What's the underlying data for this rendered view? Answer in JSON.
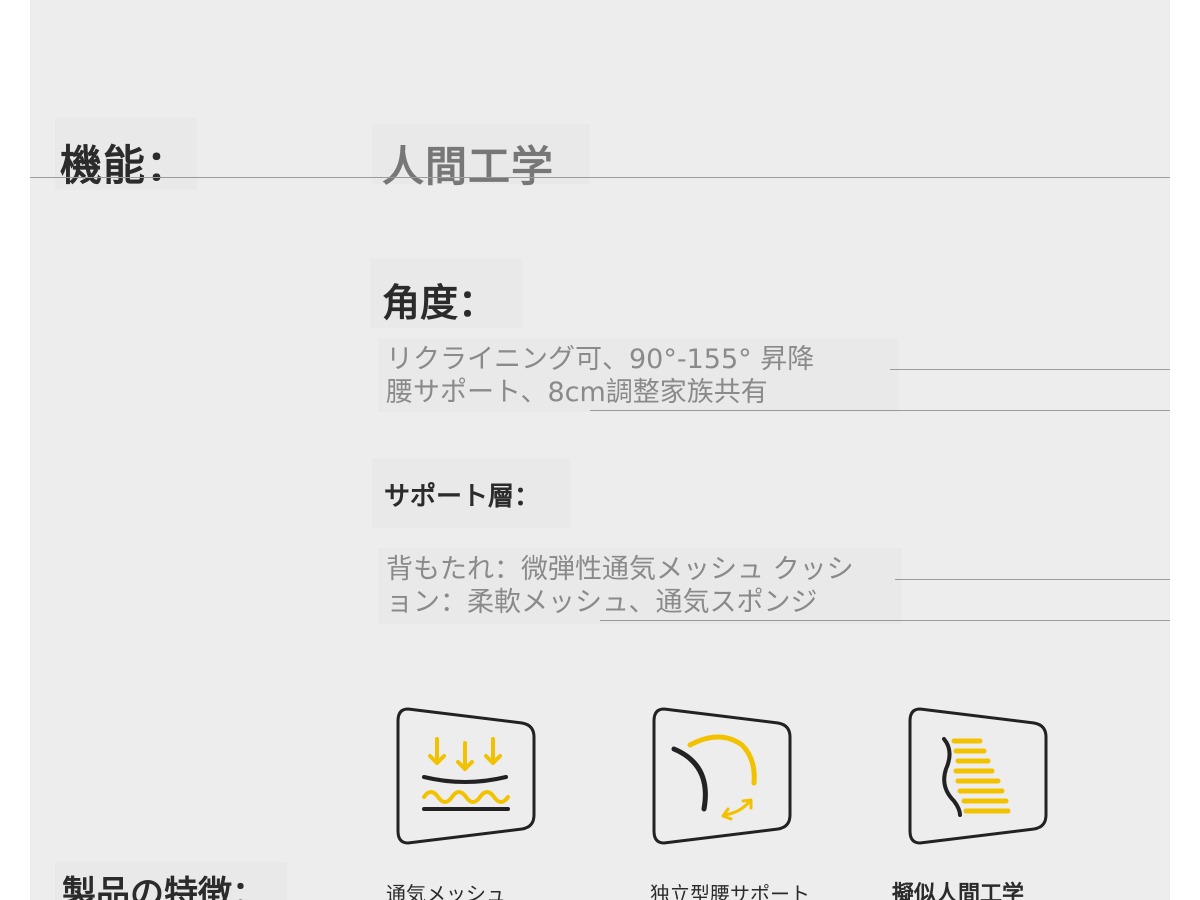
{
  "spec": {
    "function_label": "機能：",
    "function_value": "人間工学",
    "angle_label": "角度：",
    "angle_lines": [
      "リクライニング可、90°-155° 昇降",
      "腰サポート、8cm調整家族共有"
    ],
    "support_label": "サポート層：",
    "support_lines": [
      "背もたれ：微弾性通気メッシュ クッシ",
      "ョン：柔軟メッシュ、通気スポンジ"
    ]
  },
  "features": {
    "section_label": "製品の特徴：",
    "items": [
      {
        "icon": "breathable-mesh-icon",
        "caption": "通気メッシュ"
      },
      {
        "icon": "lumbar-support-icon",
        "caption": "独立型腰サポート"
      },
      {
        "icon": "ergonomic-spine-icon",
        "caption": "擬似人間工学"
      }
    ]
  },
  "colors": {
    "accent": "#f2c200",
    "stroke": "#222222",
    "panel": "#ededed"
  }
}
